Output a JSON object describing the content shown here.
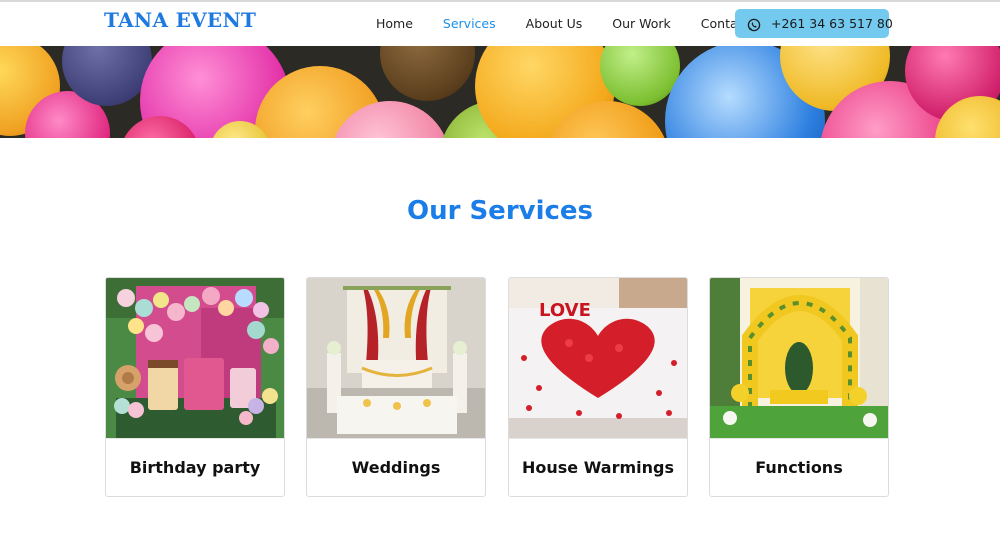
{
  "brand": {
    "name": "TANA EVENT",
    "color": "#1f7ae0"
  },
  "nav": {
    "items": [
      {
        "label": "Home",
        "active": false
      },
      {
        "label": "Services",
        "active": true
      },
      {
        "label": "About Us",
        "active": false
      },
      {
        "label": "Our Work",
        "active": false
      },
      {
        "label": "Contact",
        "active": false
      }
    ],
    "contact_button": {
      "icon": "whatsapp-icon",
      "label": "+261 34 63 517 80",
      "color": "#74c9ee"
    }
  },
  "hero": {
    "image": "colorful-balloons-banner"
  },
  "services": {
    "title": "Our Services",
    "title_color": "#1b7de8",
    "cards": [
      {
        "title": "Birthday party",
        "image": "birthday-party-balloon-decor"
      },
      {
        "title": "Weddings",
        "image": "wedding-stage-decor"
      },
      {
        "title": "House Warmings",
        "image": "rose-petal-heart-bed"
      },
      {
        "title": "Functions",
        "image": "yellow-floral-arch-stage"
      }
    ]
  }
}
